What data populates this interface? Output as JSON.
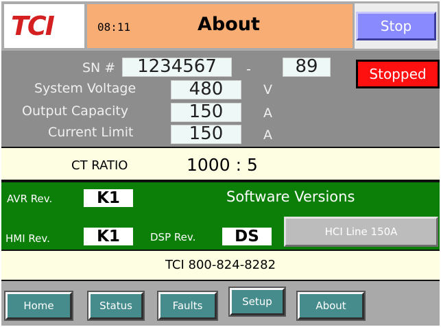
{
  "header": {
    "logo_text": "TCI",
    "time": "08:11",
    "title": "About",
    "stop_label": "Stop"
  },
  "info": {
    "sn_label": "SN #",
    "sn_value": "1234567",
    "sn_separator": "-",
    "sn_suffix": "89",
    "system_voltage_label": "System Voltage",
    "system_voltage_value": "480",
    "system_voltage_unit": "V",
    "output_capacity_label": "Output Capacity",
    "output_capacity_value": "150",
    "output_capacity_unit": "A",
    "current_limit_label": "Current Limit",
    "current_limit_value": "150",
    "current_limit_unit": "A",
    "status": "Stopped"
  },
  "ct": {
    "label": "CT RATIO",
    "value": "1000 : 5"
  },
  "software": {
    "avr_label": "AVR Rev.",
    "avr_value": "K1",
    "title": "Software Versions",
    "hmi_label": "HMI Rev.",
    "hmi_value": "K1",
    "dsp_label": "DSP Rev.",
    "dsp_value": "DS",
    "product_label": "HCI Line 150A"
  },
  "phone": "TCI 800-824-8282",
  "nav": {
    "home": "Home",
    "status": "Status",
    "faults": "Faults",
    "setup": "Setup",
    "about": "About"
  },
  "colors": {
    "title_bar": "#f8ad74",
    "stop_button": "#8a8aff",
    "status_stopped": "#ff1010",
    "info_panel": "#8d8d8d",
    "software_panel": "#0c7f08",
    "nav_button": "#468c8c",
    "logo_red": "#d42020"
  }
}
